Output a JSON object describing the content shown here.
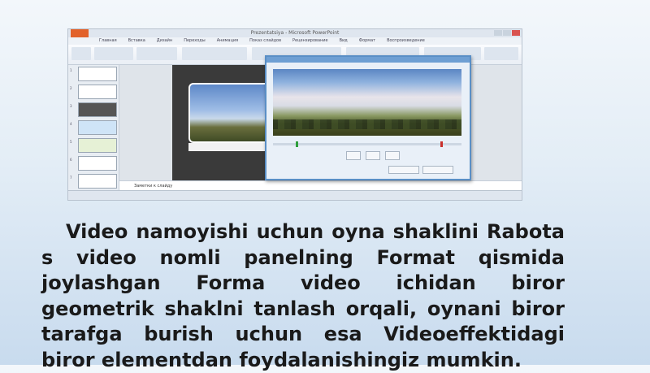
{
  "screenshot": {
    "window_title": "Prezentatsiya - Microsoft PowerPoint",
    "ribbon_tabs": [
      "Главная",
      "Вставка",
      "Дизайн",
      "Переходы",
      "Анимация",
      "Показ слайдов",
      "Рецензирование",
      "Вид",
      "Формат",
      "Воспроизведение"
    ],
    "notes_placeholder": "Заметки к слайду",
    "thumb_numbers": [
      "1",
      "2",
      "3",
      "4",
      "5",
      "6",
      "7"
    ]
  },
  "caption": {
    "text": "Video namoyishi uchun oyna shaklini Rabota s video nomli panelning Format qismida joylashgan Forma video ichidan biror geometrik shaklni tanlash orqali, oynani biror tarafga burish uchun esa Videoeffektidagi  biror elementdan foydalanishingiz mumkin."
  },
  "colors": {
    "file_tab": "#e2622b",
    "dialog_border": "#5a8fc6",
    "text": "#1a1a1a"
  }
}
